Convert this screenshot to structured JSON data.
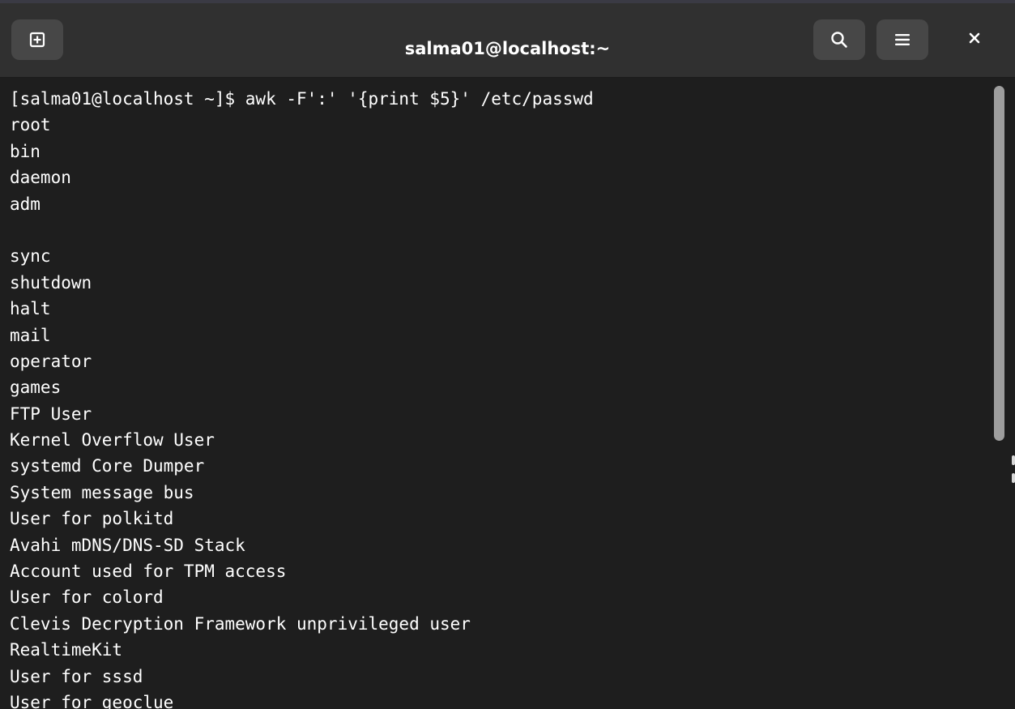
{
  "window": {
    "title": "salma01@localhost:~"
  },
  "headerbar": {
    "new_tab_icon": "new-tab-icon",
    "search_icon": "search-icon",
    "menu_icon": "hamburger-menu-icon",
    "close_icon": "close-icon"
  },
  "terminal": {
    "lines": [
      "[salma01@localhost ~]$ awk -F':' '{print $5}' /etc/passwd",
      "root",
      "bin",
      "daemon",
      "adm",
      "",
      "sync",
      "shutdown",
      "halt",
      "mail",
      "operator",
      "games",
      "FTP User",
      "Kernel Overflow User",
      "systemd Core Dumper",
      "System message bus",
      "User for polkitd",
      "Avahi mDNS/DNS-SD Stack",
      "Account used for TPM access",
      "User for colord",
      "Clevis Decryption Framework unprivileged user",
      "RealtimeKit",
      "User for sssd",
      "User for geoclue"
    ]
  },
  "colors": {
    "headerbar_bg": "#303030",
    "button_bg": "#474747",
    "terminal_bg": "#1e1e1e",
    "text": "#ffffff",
    "scroll_thumb": "#9e9e9e"
  }
}
